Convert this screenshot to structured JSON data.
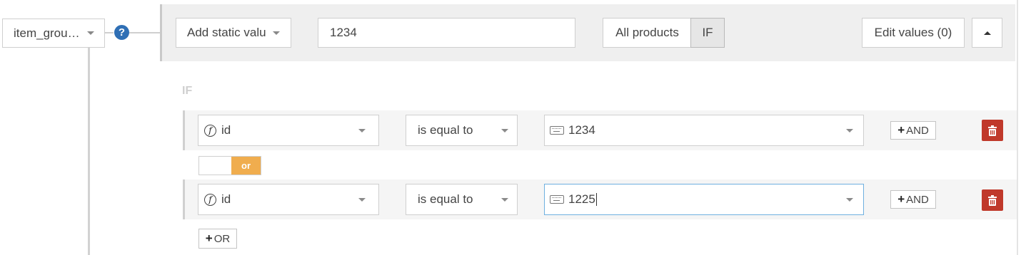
{
  "field_select": {
    "value": "item_grou…"
  },
  "help_icon": {
    "glyph": "?"
  },
  "mapping": {
    "source_select": "Add static valu",
    "static_value": "1234",
    "scope_all_label": "All products",
    "scope_if_label": "IF",
    "edit_values_label": "Edit values (0)"
  },
  "conditions": {
    "heading": "IF",
    "rows": [
      {
        "field": "id",
        "operator": "is equal to",
        "value": "1234",
        "and_label": "AND"
      },
      {
        "field": "id",
        "operator": "is equal to",
        "value": "1225",
        "and_label": "AND"
      }
    ],
    "or_toggle_label": "or",
    "add_or_label": "OR"
  },
  "colors": {
    "accent_blue": "#2f6fb5",
    "danger_red": "#c0392b",
    "or_orange": "#f0ad4e",
    "panel_grey": "#efefef"
  },
  "icons": {
    "function": "fx-icon",
    "keyboard": "keyboard-icon",
    "trash": "trash-icon",
    "plus": "plus-icon",
    "chevron_down": "chevron-down-icon",
    "chevron_up": "chevron-up-icon"
  }
}
